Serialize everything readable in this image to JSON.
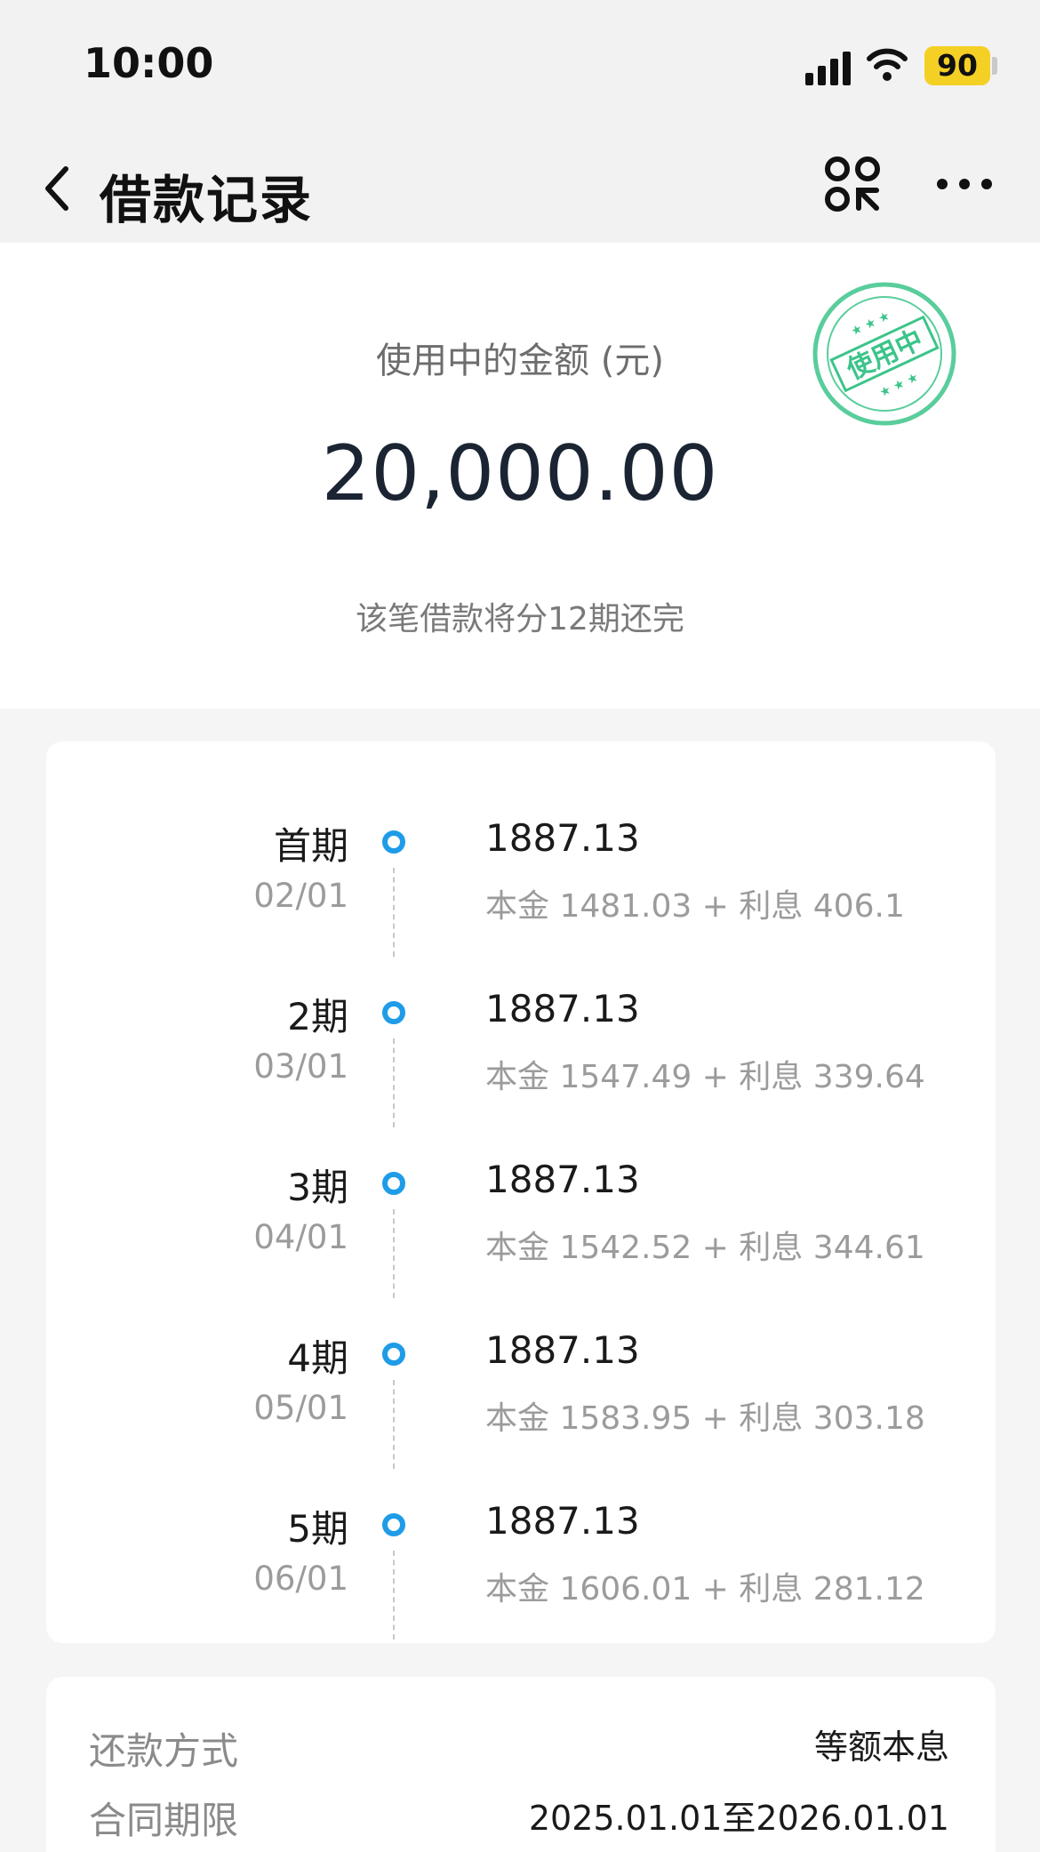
{
  "status_bar": {
    "time": "10:00",
    "battery": "90"
  },
  "header": {
    "title": "借款记录"
  },
  "summary": {
    "label": "使用中的金额 (元)",
    "amount": "20,000.00",
    "note": "该笔借款将分12期还完",
    "stamp_text": "使用中",
    "stamp_color": "#3cc48a"
  },
  "schedule": [
    {
      "period": "首期",
      "date": "02/01",
      "amount": "1887.13",
      "breakdown": "本金 1481.03 + 利息 406.1"
    },
    {
      "period": "2期",
      "date": "03/01",
      "amount": "1887.13",
      "breakdown": "本金 1547.49 + 利息 339.64"
    },
    {
      "period": "3期",
      "date": "04/01",
      "amount": "1887.13",
      "breakdown": "本金 1542.52 + 利息 344.61"
    },
    {
      "period": "4期",
      "date": "05/01",
      "amount": "1887.13",
      "breakdown": "本金 1583.95 + 利息 303.18"
    },
    {
      "period": "5期",
      "date": "06/01",
      "amount": "1887.13",
      "breakdown": "本金 1606.01 + 利息 281.12"
    }
  ],
  "details": {
    "repay_method_label": "还款方式",
    "repay_method_value": "等额本息",
    "contract_term_label": "合同期限",
    "contract_term_value": "2025.01.01至2026.01.01"
  },
  "colors": {
    "accent": "#1f9ce8",
    "battery": "#f5d024"
  }
}
